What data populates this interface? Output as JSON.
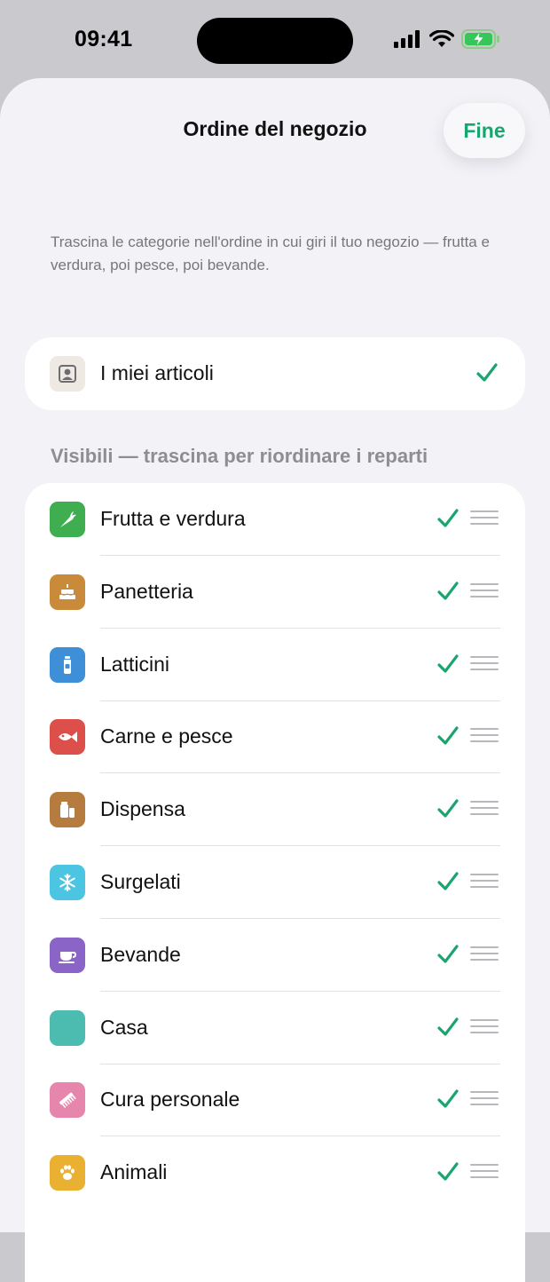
{
  "status_bar": {
    "time": "09:41"
  },
  "sheet": {
    "title": "Ordine del negozio",
    "done_label": "Fine",
    "helper_text": "Trascina le categorie nell'ordine in cui giri il tuo negozio — frutta e verdura, poi pesce, poi bevande."
  },
  "my_items": {
    "label": "I miei articoli",
    "icon": "person-square-icon",
    "checked": true
  },
  "section_header": "Visibili — trascina per riordinare i reparti",
  "accent_color": "#1aa56e",
  "categories": [
    {
      "label": "Frutta e verdura",
      "icon": "carrot-icon",
      "color": "#3fae50",
      "checked": true
    },
    {
      "label": "Panetteria",
      "icon": "cake-icon",
      "color": "#c98a3a",
      "checked": true
    },
    {
      "label": "Latticini",
      "icon": "milk-bottle-icon",
      "color": "#3f8fd8",
      "checked": true
    },
    {
      "label": "Carne e pesce",
      "icon": "fish-icon",
      "color": "#dd4f4a",
      "checked": true
    },
    {
      "label": "Dispensa",
      "icon": "pantry-jars-icon",
      "color": "#b57b3f",
      "checked": true
    },
    {
      "label": "Surgelati",
      "icon": "snowflake-icon",
      "color": "#4cc5e3",
      "checked": true
    },
    {
      "label": "Bevande",
      "icon": "cup-icon",
      "color": "#8a64c6",
      "checked": true
    },
    {
      "label": "Casa",
      "icon": "home-icon",
      "color": "#4bbcaf",
      "checked": true
    },
    {
      "label": "Cura personale",
      "icon": "comb-icon",
      "color": "#e686ac",
      "checked": true
    },
    {
      "label": "Animali",
      "icon": "paw-icon",
      "color": "#eab032",
      "checked": true
    }
  ]
}
